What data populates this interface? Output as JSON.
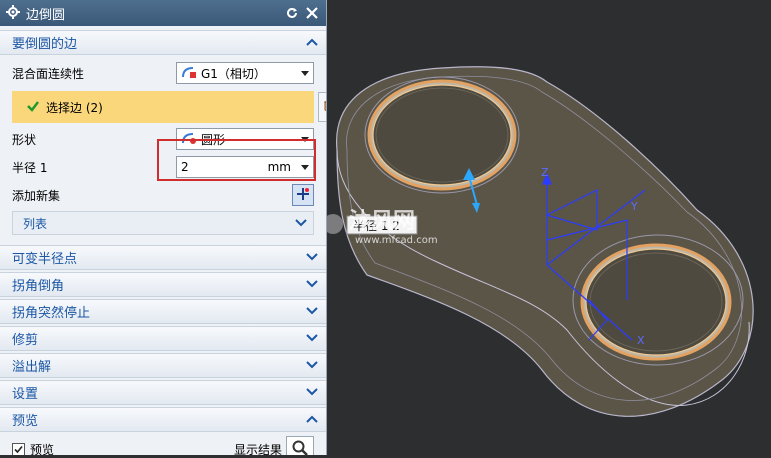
{
  "dialog": {
    "title": "边倒圆",
    "section_edge": "要倒圆的边",
    "blend_label": "混合面连续性",
    "blend_value": "G1（相切）",
    "select_edge_label": "选择边 (2)",
    "shape_label": "形状",
    "shape_value": "圆形",
    "radius_label": "半径 1",
    "radius_value": "2",
    "radius_unit": "mm",
    "add_set_label": "添加新集",
    "list_label": "列表",
    "sections": [
      "可变半径点",
      "拐角倒角",
      "拐角突然停止",
      "修剪",
      "溢出解",
      "设置"
    ],
    "preview_section": "预览",
    "preview_checkbox_label": "预览",
    "show_result_label": "显示结果"
  },
  "viewport": {
    "radius_tag": "半径 1 2",
    "axis_x": "X",
    "axis_y": "Y",
    "axis_z": "Z",
    "watermark_main": "沐风网",
    "watermark_sub": "www.mfcad.com"
  },
  "colors": {
    "accent": "#1b57a5",
    "selection": "#fbd77c",
    "highlight_box": "#d22d2d",
    "fillet_edge": "#e8a060",
    "csys": "#2b3cff"
  }
}
